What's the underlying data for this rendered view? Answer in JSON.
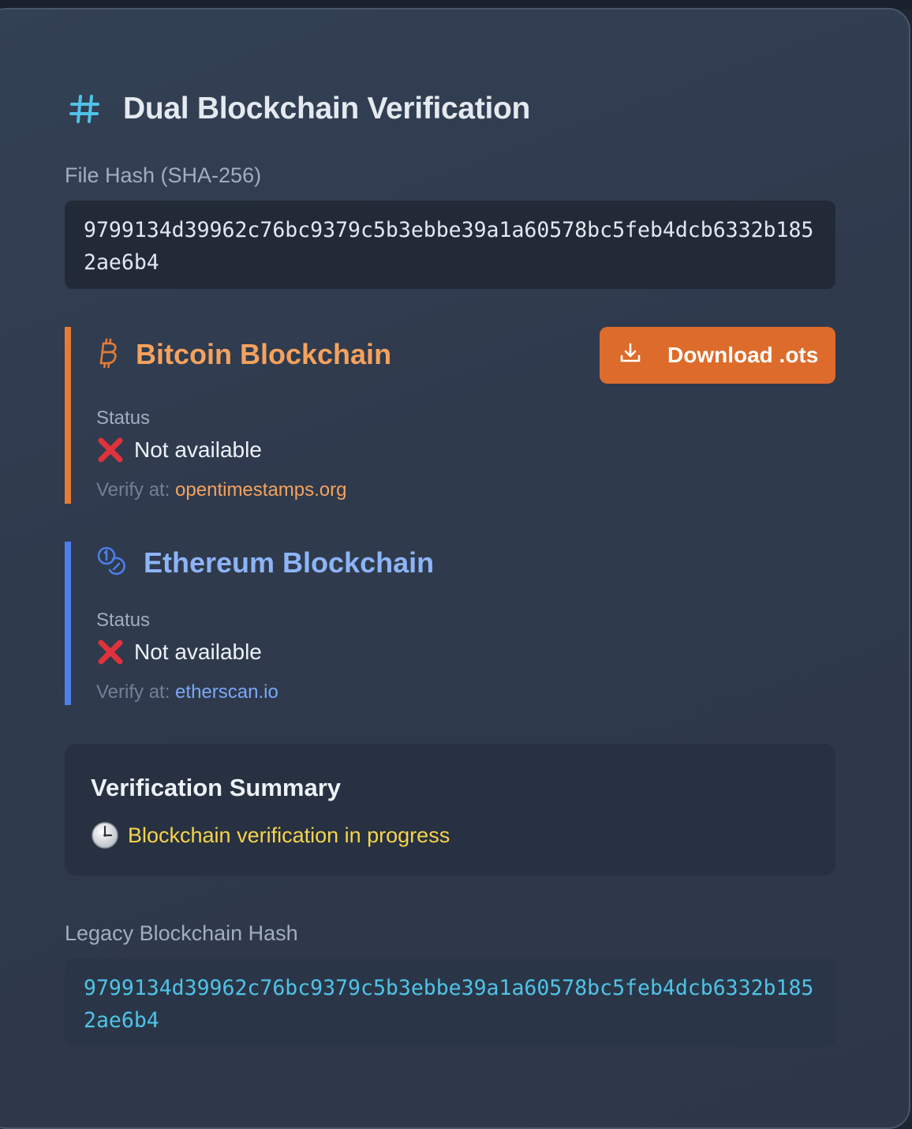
{
  "header": {
    "title": "Dual Blockchain Verification",
    "icon": "hash-icon"
  },
  "file_hash": {
    "label": "File Hash (SHA-256)",
    "value": "9799134d39962c76bc9379c5b3ebbe39a1a60578bc5feb4dcb6332b1852ae6b4"
  },
  "bitcoin": {
    "title": "Bitcoin Blockchain",
    "icon": "bitcoin-icon",
    "accent": "#e57b35",
    "download_label": "Download .ots",
    "status_label": "Status",
    "status_value": "Not available",
    "verify_prefix": "Verify at:",
    "verify_link": "opentimestamps.org"
  },
  "ethereum": {
    "title": "Ethereum Blockchain",
    "icon": "coins-icon",
    "accent": "#4c7fe8",
    "status_label": "Status",
    "status_value": "Not available",
    "verify_prefix": "Verify at:",
    "verify_link": "etherscan.io"
  },
  "summary": {
    "title": "Verification Summary",
    "status": "Blockchain verification in progress",
    "icon": "clock-icon"
  },
  "legacy_hash": {
    "label": "Legacy Blockchain Hash",
    "value": "9799134d39962c76bc9379c5b3ebbe39a1a60578bc5feb4dcb6332b1852ae6b4"
  }
}
